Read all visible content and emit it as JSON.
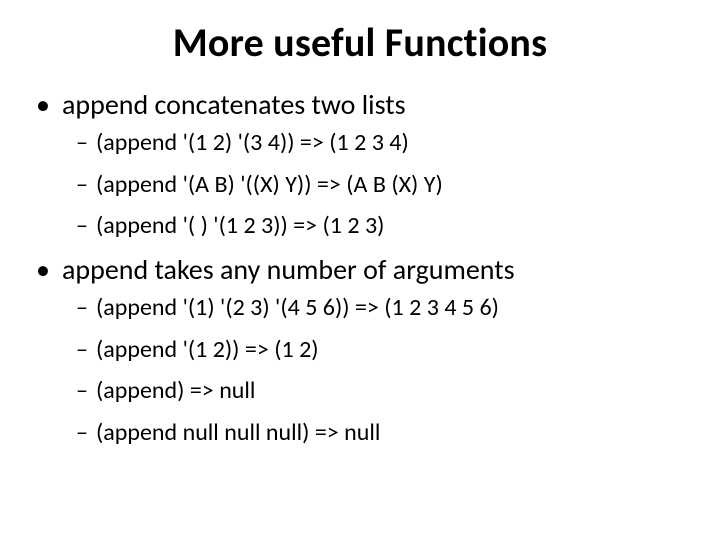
{
  "slide": {
    "title": "More useful Functions",
    "bullets": [
      {
        "text": "append concatenates two lists",
        "sub": [
          "(append '(1 2) '(3 4)) => (1 2 3 4)",
          "(append '(A B) '((X) Y)) => (A B (X) Y)",
          "(append '( ) '(1 2 3)) => (1 2 3)"
        ]
      },
      {
        "text": "append takes any number of arguments",
        "sub": [
          "(append '(1) '(2 3) '(4 5 6)) => (1 2 3 4 5 6)",
          "(append '(1 2)) => (1 2)",
          "(append) => null",
          "(append null null null) => null"
        ]
      }
    ],
    "glyphs": {
      "l1": "•",
      "l2": "–"
    }
  }
}
